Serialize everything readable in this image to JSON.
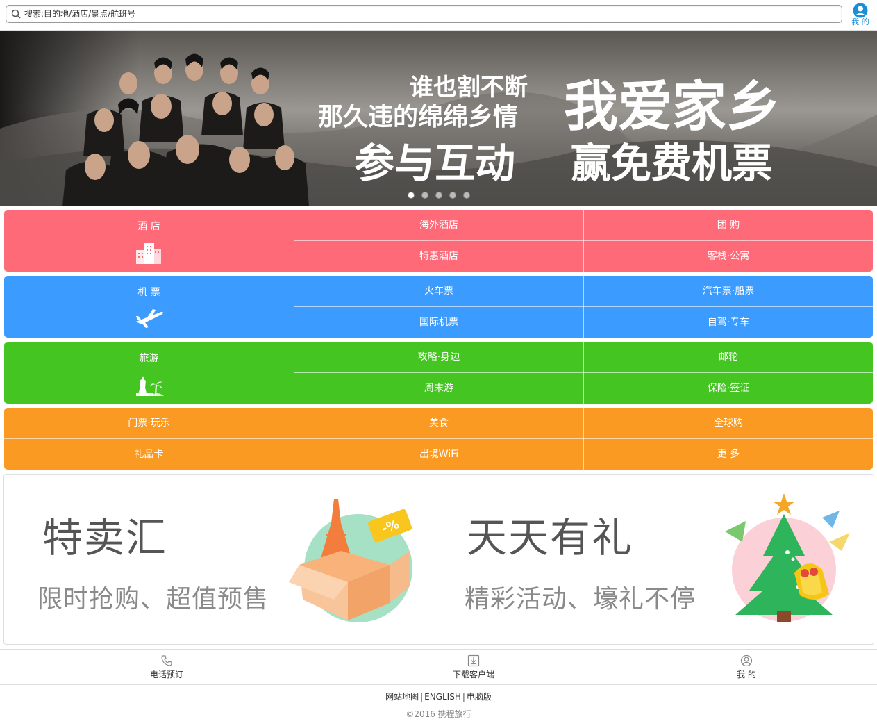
{
  "header": {
    "search_placeholder": "搜索:目的地/酒店/景点/航班号",
    "me_label": "我 的"
  },
  "banner": {
    "line1": "谁也割不断",
    "line2": "那久违的绵绵乡情",
    "headline": "我爱家乡",
    "line3": "参与互动",
    "line4": "赢免费机票",
    "slide_count": 5,
    "active_slide": 1
  },
  "categories": [
    {
      "main": "酒 店",
      "icon": "hotel-icon",
      "cells": [
        "海外酒店",
        "团 购",
        "特惠酒店",
        "客栈·公寓"
      ],
      "color": "#fe6a78"
    },
    {
      "main": "机 票",
      "icon": "airplane-icon",
      "cells": [
        "火车票",
        "汽车票·船票",
        "国际机票",
        "自驾·专车"
      ],
      "color": "#3b9bff"
    },
    {
      "main": "旅游",
      "icon": "statue-of-liberty-icon",
      "cells": [
        "攻略·身边",
        "邮轮",
        "周末游",
        "保险·签证"
      ],
      "color": "#44c522"
    },
    {
      "cells": [
        "门票·玩乐",
        "美食",
        "全球购",
        "礼品卡",
        "出境WiFi",
        "更 多"
      ],
      "color": "#fb9a22"
    }
  ],
  "promos": [
    {
      "title": "特卖汇",
      "subtitle": "限时抢购、超值预售",
      "badge": "-%"
    },
    {
      "title": "天天有礼",
      "subtitle": "精彩活动、壕礼不停"
    }
  ],
  "bottom_nav": [
    {
      "label": "电话预订",
      "icon": "phone-icon"
    },
    {
      "label": "下载客户端",
      "icon": "download-icon"
    },
    {
      "label": "我 的",
      "icon": "user-icon"
    }
  ],
  "footer": {
    "links": [
      "网站地图",
      "ENGLISH",
      "电脑版"
    ],
    "copyright": "©2016 携程旅行"
  }
}
